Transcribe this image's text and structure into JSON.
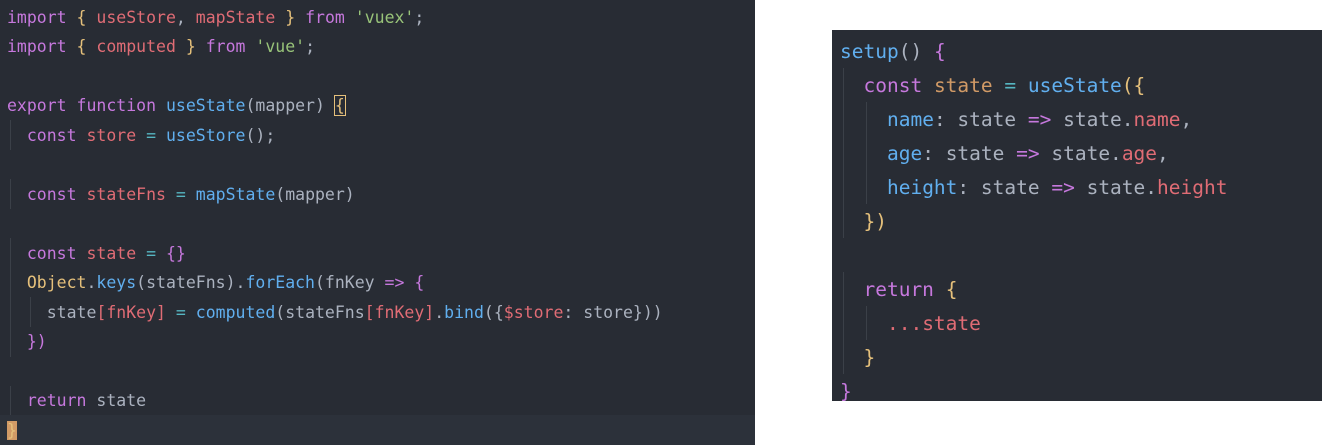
{
  "colors": {
    "background": "#282c34",
    "keyword": "#c678dd",
    "function": "#61afef",
    "string": "#98c379",
    "variable": "#e06c75",
    "plain": "#abb2bf",
    "bracket": "#e5c07b",
    "whitespace_dot": "#4b5263",
    "constant": "#d19a66",
    "operator": "#56b6c2"
  },
  "left_editor": {
    "lines": [
      [
        {
          "t": "import",
          "c": "keyword"
        },
        {
          "t": " { ",
          "c": "bracket"
        },
        {
          "t": "useStore",
          "c": "variable"
        },
        {
          "t": ", ",
          "c": "plain"
        },
        {
          "t": "mapState",
          "c": "variable"
        },
        {
          "t": " } ",
          "c": "bracket"
        },
        {
          "t": "from",
          "c": "keyword"
        },
        {
          "t": " ",
          "c": "plain"
        },
        {
          "t": "'vuex'",
          "c": "string"
        },
        {
          "t": ";",
          "c": "plain"
        }
      ],
      [
        {
          "t": "import",
          "c": "keyword"
        },
        {
          "t": " { ",
          "c": "bracket"
        },
        {
          "t": "computed",
          "c": "variable"
        },
        {
          "t": " } ",
          "c": "bracket"
        },
        {
          "t": "from",
          "c": "keyword"
        },
        {
          "t": " ",
          "c": "plain"
        },
        {
          "t": "'vue'",
          "c": "string"
        },
        {
          "t": ";",
          "c": "plain"
        }
      ],
      [],
      [
        {
          "t": "export",
          "c": "keyword"
        },
        {
          "t": " ",
          "c": "plain"
        },
        {
          "t": "function",
          "c": "keyword"
        },
        {
          "t": " ",
          "c": "plain"
        },
        {
          "t": "useState",
          "c": "function"
        },
        {
          "t": "(",
          "c": "plain"
        },
        {
          "t": "mapper",
          "c": "plain"
        },
        {
          "t": ") ",
          "c": "plain"
        },
        {
          "t": "{",
          "c": "bracket",
          "box": true
        }
      ],
      [
        {
          "t": "  ",
          "c": "plain"
        },
        {
          "t": "const",
          "c": "keyword"
        },
        {
          "t": " ",
          "c": "plain"
        },
        {
          "t": "store",
          "c": "variable"
        },
        {
          "t": " = ",
          "c": "operator"
        },
        {
          "t": "useStore",
          "c": "function"
        },
        {
          "t": "();",
          "c": "plain"
        }
      ],
      [],
      [
        {
          "t": "  ",
          "c": "plain"
        },
        {
          "t": "const",
          "c": "keyword"
        },
        {
          "t": " ",
          "c": "plain"
        },
        {
          "t": "stateFns",
          "c": "variable"
        },
        {
          "t": " = ",
          "c": "operator"
        },
        {
          "t": "mapState",
          "c": "function"
        },
        {
          "t": "(mapper)",
          "c": "plain"
        }
      ],
      [],
      [
        {
          "t": "  ",
          "c": "plain"
        },
        {
          "t": "const",
          "c": "keyword"
        },
        {
          "t": " ",
          "c": "plain"
        },
        {
          "t": "state",
          "c": "variable"
        },
        {
          "t": " = ",
          "c": "operator"
        },
        {
          "t": "{}",
          "c": "keyword"
        }
      ],
      [
        {
          "t": "  ",
          "c": "plain"
        },
        {
          "t": "Object",
          "c": "bracket"
        },
        {
          "t": ".",
          "c": "plain"
        },
        {
          "t": "keys",
          "c": "function"
        },
        {
          "t": "(stateFns).",
          "c": "plain"
        },
        {
          "t": "forEach",
          "c": "function"
        },
        {
          "t": "(fnKey ",
          "c": "plain"
        },
        {
          "t": "=>",
          "c": "keyword"
        },
        {
          "t": " {",
          "c": "keyword"
        }
      ],
      [
        {
          "t": "    ",
          "c": "plain"
        },
        {
          "t": "state",
          "c": "plain"
        },
        {
          "t": "[fnKey]",
          "c": "variable"
        },
        {
          "t": " = ",
          "c": "operator"
        },
        {
          "t": "computed",
          "c": "function"
        },
        {
          "t": "(stateFns",
          "c": "plain"
        },
        {
          "t": "[fnKey]",
          "c": "variable"
        },
        {
          "t": ".",
          "c": "plain"
        },
        {
          "t": "bind",
          "c": "function"
        },
        {
          "t": "({",
          "c": "plain"
        },
        {
          "t": "$store",
          "c": "variable"
        },
        {
          "t": ": store}))",
          "c": "plain"
        }
      ],
      [
        {
          "t": "  ",
          "c": "plain"
        },
        {
          "t": "})",
          "c": "keyword"
        }
      ],
      [],
      [
        {
          "t": "  ",
          "c": "plain"
        },
        {
          "t": "return",
          "c": "keyword"
        },
        {
          "t": " ",
          "c": "plain"
        },
        {
          "t": "state",
          "c": "plain"
        }
      ],
      [
        {
          "t": "}",
          "c": "bracket",
          "cursor": true
        }
      ]
    ]
  },
  "right_editor": {
    "lines": [
      [
        {
          "t": "setup",
          "c": "function"
        },
        {
          "t": "() ",
          "c": "plain"
        },
        {
          "t": "{",
          "c": "keyword"
        }
      ],
      [
        {
          "t": "  ",
          "c": "plain"
        },
        {
          "t": "const",
          "c": "keyword"
        },
        {
          "t": " ",
          "c": "plain"
        },
        {
          "t": "state",
          "c": "constant"
        },
        {
          "t": " = ",
          "c": "operator"
        },
        {
          "t": "useState",
          "c": "function"
        },
        {
          "t": "({",
          "c": "bracket"
        }
      ],
      [
        {
          "t": "    ",
          "c": "plain"
        },
        {
          "t": "name",
          "c": "function"
        },
        {
          "t": ": ",
          "c": "plain"
        },
        {
          "t": "state",
          "c": "plain"
        },
        {
          "t": " => ",
          "c": "keyword"
        },
        {
          "t": "state.",
          "c": "plain"
        },
        {
          "t": "name",
          "c": "variable"
        },
        {
          "t": ",",
          "c": "plain"
        }
      ],
      [
        {
          "t": "    ",
          "c": "plain"
        },
        {
          "t": "age",
          "c": "function"
        },
        {
          "t": ": ",
          "c": "plain"
        },
        {
          "t": "state",
          "c": "plain"
        },
        {
          "t": " => ",
          "c": "keyword"
        },
        {
          "t": "state.",
          "c": "plain"
        },
        {
          "t": "age",
          "c": "variable"
        },
        {
          "t": ",",
          "c": "plain"
        }
      ],
      [
        {
          "t": "    ",
          "c": "plain"
        },
        {
          "t": "height",
          "c": "function"
        },
        {
          "t": ": ",
          "c": "plain"
        },
        {
          "t": "state",
          "c": "plain"
        },
        {
          "t": " => ",
          "c": "keyword"
        },
        {
          "t": "state.",
          "c": "plain"
        },
        {
          "t": "height",
          "c": "variable"
        }
      ],
      [
        {
          "t": "  ",
          "c": "plain"
        },
        {
          "t": "})",
          "c": "bracket"
        }
      ],
      [],
      [
        {
          "t": "  ",
          "c": "plain"
        },
        {
          "t": "return",
          "c": "keyword"
        },
        {
          "t": " ",
          "c": "plain"
        },
        {
          "t": "{",
          "c": "bracket"
        }
      ],
      [
        {
          "t": "    ",
          "c": "plain"
        },
        {
          "t": "...state",
          "c": "variable"
        }
      ],
      [
        {
          "t": "  ",
          "c": "plain"
        },
        {
          "t": "}",
          "c": "bracket"
        }
      ],
      [
        {
          "t": "}",
          "c": "keyword"
        }
      ]
    ]
  }
}
